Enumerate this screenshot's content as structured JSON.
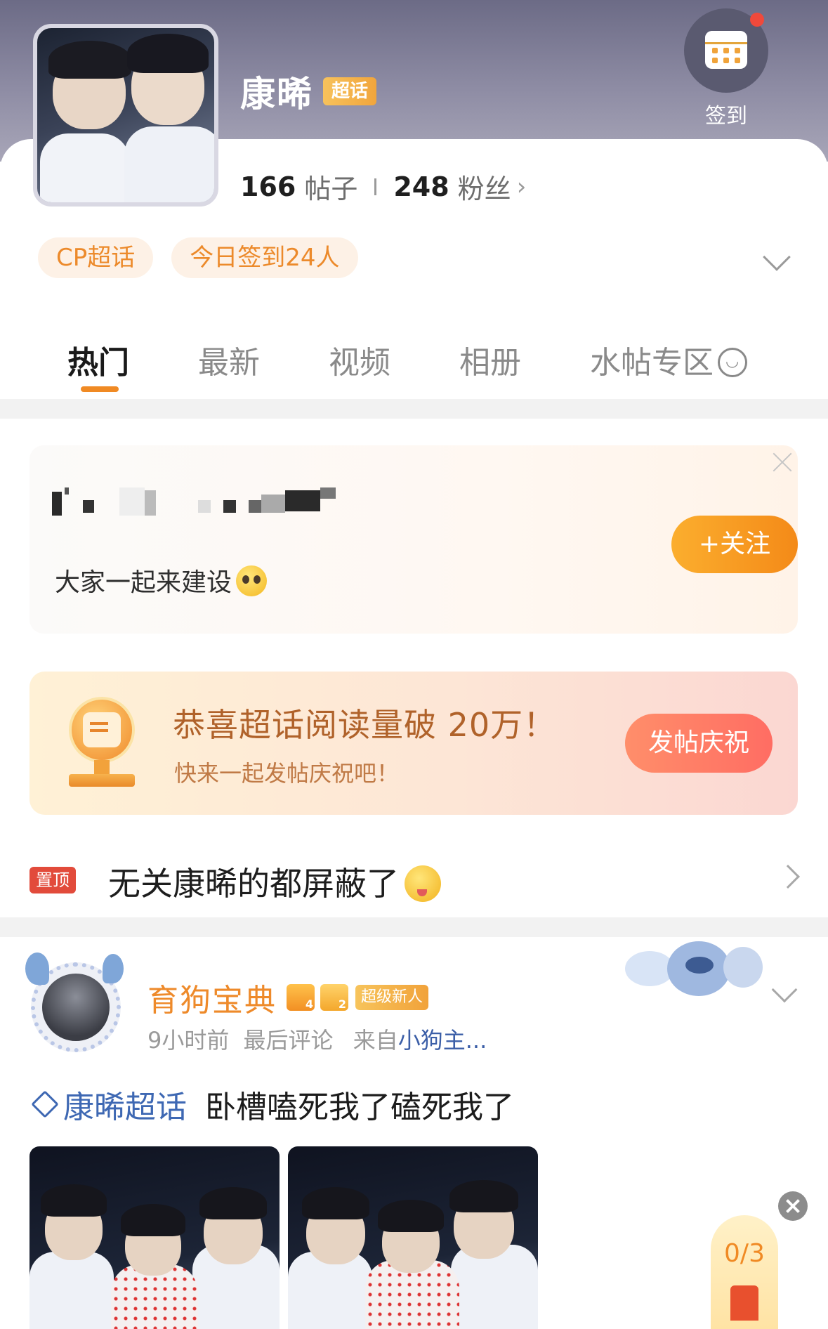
{
  "header": {
    "title": "康晞",
    "title_tag": "超话",
    "signin_label": "签到",
    "posts_count": "166",
    "posts_label": "帖子",
    "fans_count": "248",
    "fans_label": "粉丝"
  },
  "pills": [
    "CP超话",
    "今日签到24人"
  ],
  "tabs": [
    "热门",
    "最新",
    "视频",
    "相册",
    "水帖专区"
  ],
  "active_tab": "热门",
  "notice": {
    "text": "大家一起来建设",
    "follow_label": "+关注"
  },
  "banner": {
    "title": "恭喜超话阅读量破 20万！",
    "subtitle": "快来一起发帖庆祝吧！",
    "button_label": "发帖庆祝"
  },
  "pinned": {
    "badge": "置顶",
    "text": "无关康晞的都屏蔽了"
  },
  "post": {
    "username": "育狗宝典",
    "badge_label": "超级新人",
    "time": "9小时前",
    "meta_mid": "最后评论",
    "meta_from": "来自",
    "source": "小狗主...",
    "topic": "康晞超话",
    "body": "卧槽嗑死我了磕死我了"
  },
  "task": {
    "count": "0/3"
  },
  "colors": {
    "accent_orange": "#f08a24",
    "link_blue": "#3e68b3",
    "pin_red": "#e24b3b"
  },
  "icons": [
    "calendar-icon",
    "chevron-right-icon",
    "chevron-down-icon",
    "close-icon",
    "trophy-icon",
    "crown-icon",
    "gem-icon",
    "topic-diamond-icon"
  ]
}
